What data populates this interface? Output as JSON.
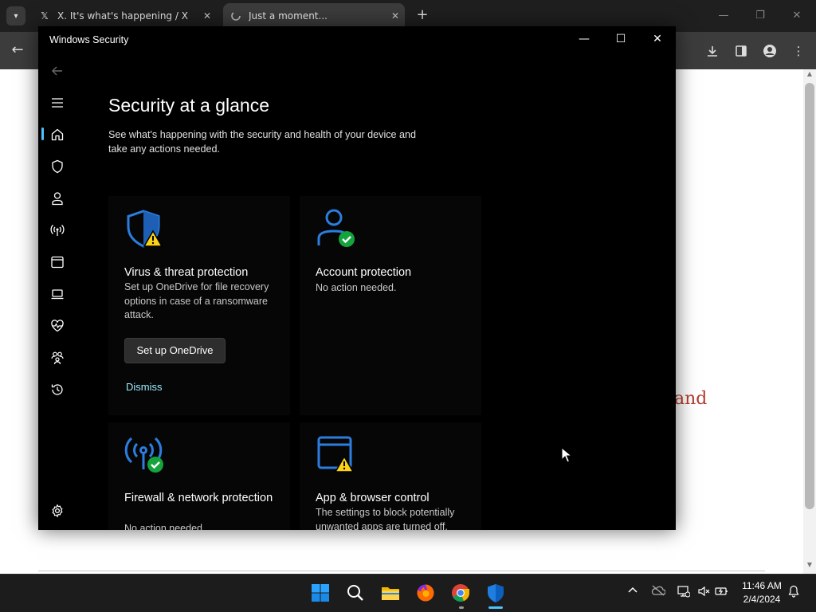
{
  "browser": {
    "tabs": [
      {
        "title": "X. It's what's happening / X",
        "favicon": "x-logo-icon"
      },
      {
        "title": "Just a moment...",
        "favicon": "loading-icon"
      }
    ],
    "new_tab": "+",
    "page_text_fragment": "and"
  },
  "window": {
    "title": "Windows Security",
    "controls": {
      "minimize": "—",
      "maximize": "☐",
      "close": "✕"
    }
  },
  "nav": {
    "items": [
      {
        "name": "back-icon"
      },
      {
        "name": "menu-icon"
      },
      {
        "name": "home-icon",
        "selected": true
      },
      {
        "name": "shield-icon"
      },
      {
        "name": "person-icon"
      },
      {
        "name": "wifi-antenna-icon"
      },
      {
        "name": "app-browser-icon"
      },
      {
        "name": "laptop-icon"
      },
      {
        "name": "heart-pulse-icon"
      },
      {
        "name": "family-icon"
      },
      {
        "name": "history-icon"
      },
      {
        "name": "settings-icon"
      }
    ]
  },
  "main": {
    "title": "Security at a glance",
    "subtitle": "See what's happening with the security and health of your device and take any actions needed.",
    "cards": [
      {
        "title": "Virus & threat protection",
        "description": "Set up OneDrive for file recovery options in case of a ransomware attack.",
        "status": "warning",
        "button": "Set up OneDrive",
        "link": "Dismiss"
      },
      {
        "title": "Account protection",
        "description": "No action needed.",
        "status": "ok"
      },
      {
        "title": "Firewall & network protection",
        "description": "No action needed.",
        "status": "ok"
      },
      {
        "title": "App & browser control",
        "description": "The settings to block potentially unwanted apps are turned off.",
        "status": "warning"
      }
    ]
  },
  "taskbar": {
    "apps": [
      "start-icon",
      "search-icon",
      "file-explorer-icon",
      "firefox-icon",
      "chrome-icon",
      "windows-security-icon"
    ],
    "time": "11:46 AM",
    "date": "2/4/2024"
  },
  "colors": {
    "accent": "#4cc2ff",
    "link": "#99ebff",
    "warning": "#fcd116",
    "ok": "#15a33d",
    "icon_blue": "#2b7de0"
  }
}
